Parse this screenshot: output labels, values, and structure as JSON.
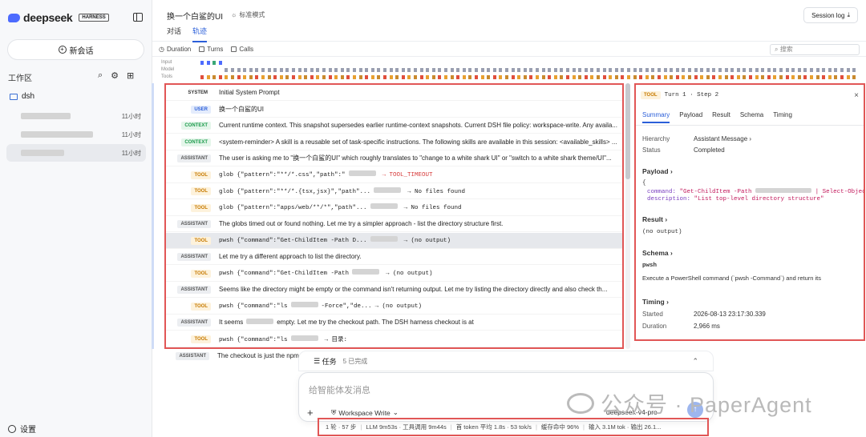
{
  "sidebar": {
    "brand": "deepseek",
    "brand_badge": "HARNESS",
    "new_chat": "新会话",
    "workspace_label": "工作区",
    "folder": "dsh",
    "sessions": [
      {
        "time": "11小时"
      },
      {
        "time": "11小时"
      },
      {
        "time": "11小时"
      }
    ],
    "settings": "设置"
  },
  "header": {
    "title": "换一个白鲨的UI",
    "mode": "标准模式",
    "tabs": [
      "对话",
      "轨迹"
    ],
    "active_tab": "轨迹",
    "session_log": "Session log"
  },
  "toolbar": {
    "items": [
      "Duration",
      "Turns",
      "Calls"
    ],
    "search_placeholder": "搜索"
  },
  "timeline": {
    "labels": [
      "Input",
      "Model",
      "Tools"
    ]
  },
  "trace": {
    "rows": [
      {
        "role": "SYSTEM",
        "kind": "system",
        "text": "Initial System Prompt"
      },
      {
        "role": "USER",
        "kind": "user",
        "text": "换一个白鲨的UI"
      },
      {
        "role": "CONTEXT",
        "kind": "context",
        "text": "Current runtime context. This snapshot supersedes earlier runtime-context snapshots. Current DSH file policy: workspace-write. Any availa..."
      },
      {
        "role": "CONTEXT",
        "kind": "context",
        "text": "<system-reminder> A skill is a reusable set of task-specific instructions. The following skills are available in this session: <available_skills> ..."
      },
      {
        "role": "ASSISTANT",
        "kind": "assistant",
        "text": "The user is asking me to \"换一个白鲨的UI\" which roughly translates to \"change to a white shark UI\" or \"switch to a white shark theme/UI\"..."
      },
      {
        "role": "TOOL",
        "kind": "tool",
        "text": "glob {\"pattern\":\"**/*.css\",\"path\":\"",
        "result": "→ TOOL_TIMEOUT",
        "error": true
      },
      {
        "role": "TOOL",
        "kind": "tool",
        "text": "glob {\"pattern\":\"**/*.{tsx,jsx}\",\"path\"...",
        "result": "→ No files found"
      },
      {
        "role": "TOOL",
        "kind": "tool",
        "text": "glob {\"pattern\":\"apps/web/**/*\",\"path\"...",
        "result": "→ No files found"
      },
      {
        "role": "ASSISTANT",
        "kind": "assistant",
        "text": "The globs timed out or found nothing. Let me try a simpler approach - list the directory structure first."
      },
      {
        "role": "TOOL",
        "kind": "tool",
        "text": "pwsh {\"command\":\"Get-ChildItem -Path D...",
        "result": "→ (no output)",
        "selected": true
      },
      {
        "role": "ASSISTANT",
        "kind": "assistant",
        "text": "Let me try a different approach to list the directory."
      },
      {
        "role": "TOOL",
        "kind": "tool",
        "text": "pwsh {\"command\":\"Get-ChildItem -Path",
        "result": "→ (no output)"
      },
      {
        "role": "ASSISTANT",
        "kind": "assistant",
        "text": "Seems like the directory might be empty or the command isn't returning output. Let me try listing the directory directly and also check th..."
      },
      {
        "role": "TOOL",
        "kind": "tool",
        "text": "pwsh {\"command\":\"ls",
        "mid": "-Force\",\"de...",
        "result": "→ (no output)"
      },
      {
        "role": "ASSISTANT",
        "kind": "assistant",
        "text": "It seems",
        "mid": "empty. Let me try the checkout path. The DSH harness checkout is at"
      },
      {
        "role": "TOOL",
        "kind": "tool",
        "text": "pwsh {\"command\":\"ls",
        "result": "→ 目录:"
      }
    ],
    "below_row": {
      "role": "ASSISTANT",
      "text": "The checkout is just the npm"
    }
  },
  "panel": {
    "badge": "TOOL",
    "turn_step": "Turn 1 · Step 2",
    "tabs": [
      "Summary",
      "Payload",
      "Result",
      "Schema",
      "Timing"
    ],
    "active_tab": "Summary",
    "hierarchy_key": "Hierarchy",
    "hierarchy_val": "Assistant Message",
    "status_key": "Status",
    "status_val": "Completed",
    "payload_title": "Payload",
    "payload_open": "{",
    "payload_command_key": "command:",
    "payload_command_val": "\"Get-ChildItem -Path",
    "payload_command_tail": "| Select-Object",
    "payload_desc_key": "description:",
    "payload_desc_val": "\"List top-level directory structure\"",
    "result_title": "Result",
    "result_val": "(no output)",
    "schema_title": "Schema",
    "schema_name": "pwsh",
    "schema_desc": "Execute a PowerShell command (`pwsh -Command`) and return its",
    "timing_title": "Timing",
    "started_key": "Started",
    "started_val": "2026-08-13 23:17:30.339",
    "duration_key": "Duration",
    "duration_val": "2,966 ms"
  },
  "tasks": {
    "label": "任务",
    "count": "5 已完成"
  },
  "composer": {
    "placeholder": "给智能体发消息",
    "permission": "Workspace Write",
    "model": "deepseek-v4-pro"
  },
  "watermark": "公众号 · PaperAgent",
  "status_bar": [
    "1 轮 · 57 步",
    "LLM 9m53s · 工具调用 9m44s",
    "首 token 平均 1.8s · 53 tok/s",
    "缓存命中 96%",
    "输入 3.1M tok · 输出 26.1..."
  ],
  "colors": {
    "accent": "#2b5fd9",
    "highlight_border": "#e15656",
    "tool_badge": "#c77a00",
    "context_badge": "#1a9a4a"
  }
}
